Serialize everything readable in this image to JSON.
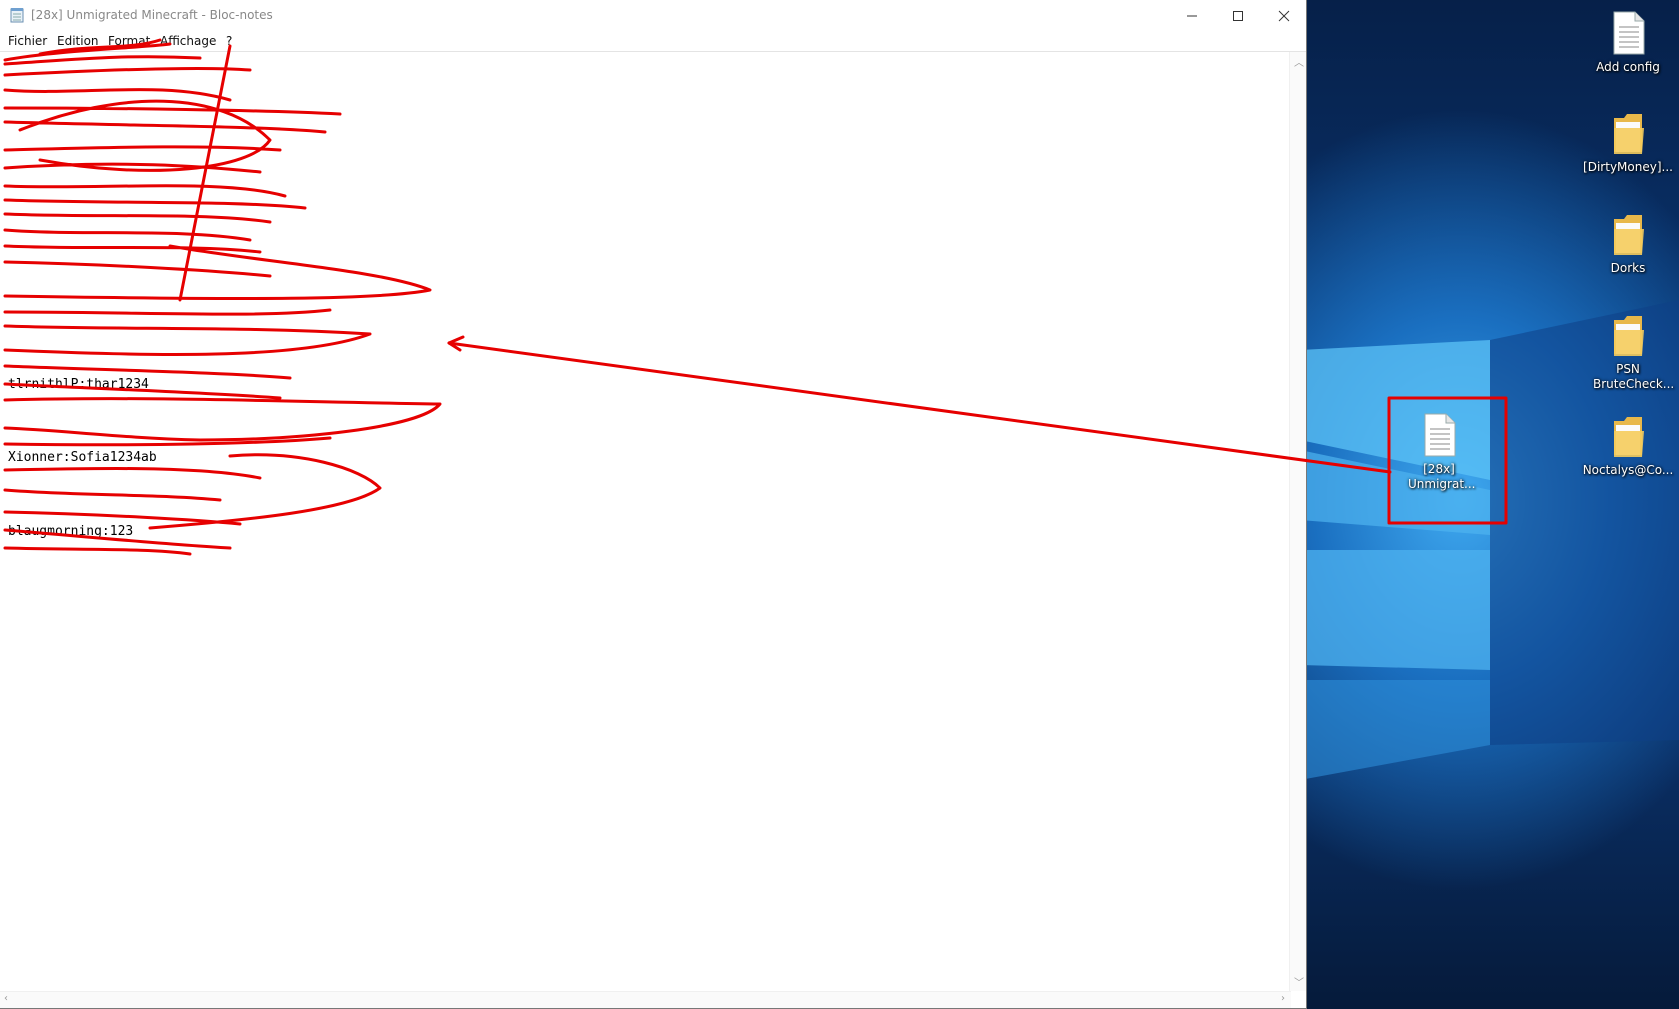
{
  "window": {
    "title": "[28x] Unmigrated Minecraft - Bloc-notes",
    "controls": [
      "minimize",
      "maximize",
      "close"
    ]
  },
  "menu": {
    "items": [
      "Fichier",
      "Edition",
      "Format",
      "Affichage",
      "?"
    ]
  },
  "editor": {
    "lines": [
      "Xionner:Sofia1234ab",
      "blaugmorning:123",
      "tlrnithlP:thar1234"
    ]
  },
  "desktop": {
    "icons": [
      {
        "label": "Add config",
        "type": "document-icon"
      },
      {
        "label": "[DirtyMoney]...",
        "type": "folder-icon"
      },
      {
        "label": "Dorks",
        "type": "folder-icon"
      },
      {
        "label": "PSN BruteCheck...",
        "type": "folder-icon"
      },
      {
        "label": "Noctalys@Co...",
        "type": "folder-icon"
      },
      {
        "label": "[28x] Unmigrat...",
        "type": "document-icon"
      }
    ]
  },
  "colors": {
    "annotation": "#e60000",
    "desktop_blue": "#1a6fc0"
  }
}
